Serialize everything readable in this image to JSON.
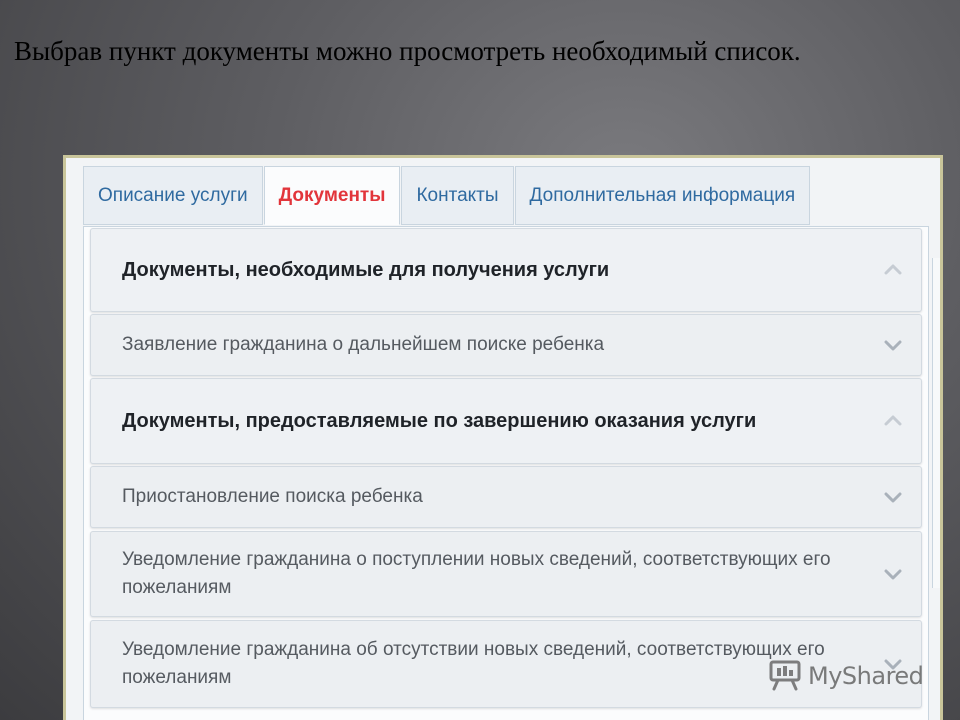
{
  "slide": {
    "title": "Выбрав пункт документы можно просмотреть необходимый список."
  },
  "tabs": [
    {
      "label": "Описание услуги",
      "active": false
    },
    {
      "label": "Документы",
      "active": true
    },
    {
      "label": "Контакты",
      "active": false
    },
    {
      "label": "Дополнительная информация",
      "active": false
    }
  ],
  "sections": [
    {
      "header": "Документы, необходимые для получения услуги",
      "items": [
        "Заявление гражданина о дальнейшем поиске ребенка"
      ]
    },
    {
      "header": "Документы, предоставляемые по завершению оказания услуги",
      "items": [
        "Приостановление поиска ребенка",
        "Уведомление гражданина о поступлении новых сведений, соответствующих его пожеланиям",
        "Уведомление гражданина об отсутствии новых сведений, соответствующих его пожеланиям"
      ]
    }
  ],
  "icons": {
    "section_toggle": "chevron-up-icon",
    "item_toggle": "chevron-down-icon"
  },
  "watermark": {
    "text": "MyShared"
  },
  "colors": {
    "tab_text": "#2f6aa0",
    "active_tab_text": "#e2353b",
    "frame_border": "#c9c59a"
  }
}
